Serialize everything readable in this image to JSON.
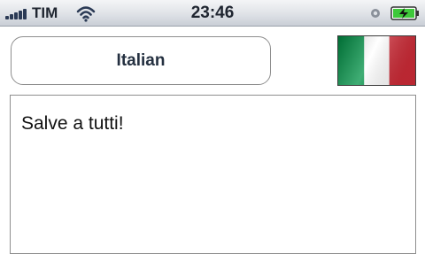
{
  "status_bar": {
    "carrier": "TIM",
    "time": "23:46",
    "icons": [
      "signal-bars-icon",
      "wifi-icon",
      "lock-icon",
      "battery-charging-icon"
    ]
  },
  "language_selector": {
    "label": "Italian",
    "flag_icon": "italy-flag-icon",
    "flag_colors": [
      "#009246",
      "#ffffff",
      "#ce2b37"
    ]
  },
  "text_area": {
    "value": "Salve a tutti!"
  }
}
